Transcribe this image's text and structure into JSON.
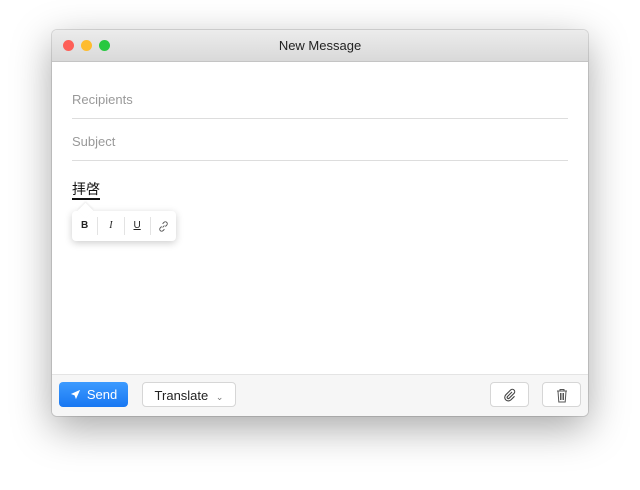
{
  "window": {
    "title": "New Message"
  },
  "compose": {
    "recipients_placeholder": "Recipients",
    "subject_placeholder": "Subject",
    "body_text": "拝啓"
  },
  "format_popup": {
    "bold": "B",
    "italic": "I",
    "underline": "U"
  },
  "footer": {
    "send_label": "Send",
    "translate_label": "Translate"
  },
  "colors": {
    "accent": "#1877f2",
    "close": "#fe5f57",
    "minimize": "#febc2e",
    "zoom": "#28c840"
  }
}
